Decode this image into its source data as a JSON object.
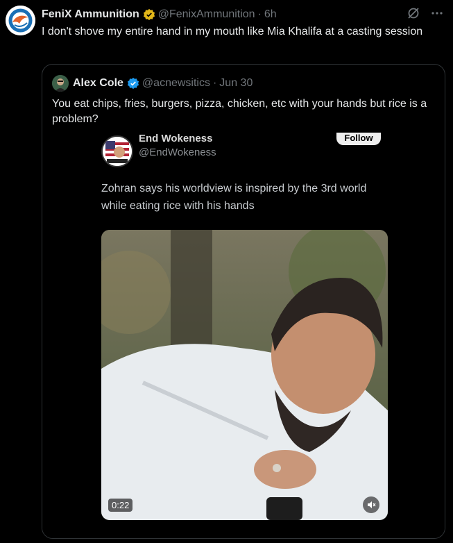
{
  "tweet": {
    "author_name": "FeniX Ammunition",
    "author_handle": "@FenixAmmunition",
    "separator": "·",
    "time": "6h",
    "text": "I don't shove my entire hand in my mouth like Mia Khalifa at a casting session",
    "avatar_icon": "fenix-logo-icon",
    "badge_icon": "verified-gold-badge-icon",
    "badge_color": "#e2b719"
  },
  "actions": {
    "grok_icon": "grok-icon",
    "more_icon": "more-dots-icon"
  },
  "quote": {
    "author_name": "Alex Cole",
    "author_handle": "@acnewsitics",
    "separator": "·",
    "time": "Jun 30",
    "text": "You eat chips, fries, burgers, pizza, chicken, etc with your hands but rice is a problem?",
    "badge_icon": "verified-blue-badge-icon",
    "badge_color": "#1d9bf0"
  },
  "embedded_post": {
    "author_name": "End Wokeness",
    "author_handle": "@EndWokeness",
    "follow_label": "Follow",
    "text": "Zohran says his worldview is inspired by the 3rd world while eating rice with his hands",
    "video_duration": "0:22",
    "mute_icon": "volume-muted-icon"
  },
  "colors": {
    "background": "#000000",
    "text_primary": "#e7e9ea",
    "text_secondary": "#71767b",
    "border": "#2f3336"
  }
}
